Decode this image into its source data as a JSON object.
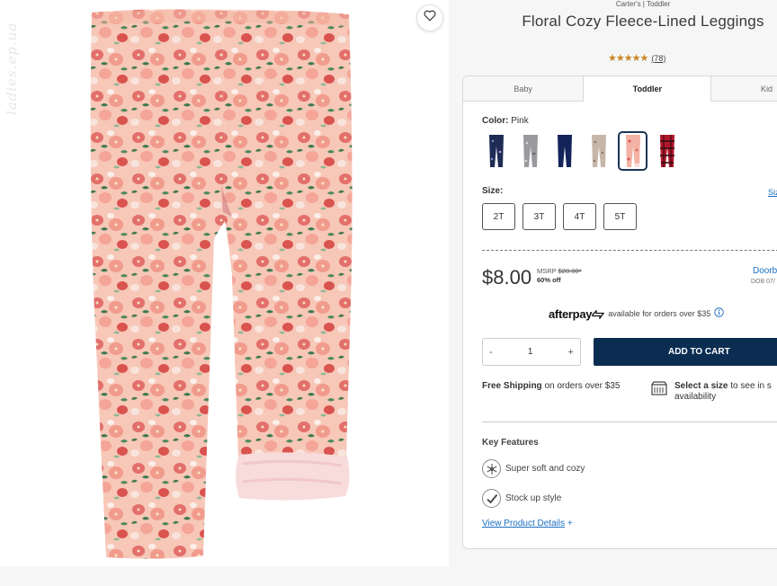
{
  "watermark": "ladies.ep.ua",
  "product": {
    "brand_line": "Carter's | Toddler",
    "title": "Floral Cozy Fleece-Lined Leggings",
    "rating_stars": "★★★★★",
    "rating_value": 4.5,
    "review_count": "(78)"
  },
  "tabs": [
    {
      "label": "Baby"
    },
    {
      "label": "Toddler",
      "active": true
    },
    {
      "label": "Kid"
    }
  ],
  "color": {
    "label": "Color:",
    "selected": "Pink",
    "swatches": [
      {
        "name": "navy-print",
        "color": "#1e2b55"
      },
      {
        "name": "gray-print",
        "color": "#9a9a9e"
      },
      {
        "name": "navy",
        "color": "#13245a"
      },
      {
        "name": "taupe-print",
        "color": "#c6b6aa"
      },
      {
        "name": "pink-floral",
        "color": "#f3b2a4",
        "selected": true
      },
      {
        "name": "red-plaid",
        "color": "#b0162a"
      }
    ]
  },
  "size": {
    "label": "Size:",
    "options": [
      "2T",
      "3T",
      "4T",
      "5T"
    ],
    "guide_label": "Siz"
  },
  "pricing": {
    "price": "$8.00",
    "msrp_label": "MSRP",
    "msrp_value": "$20.00*",
    "discount": "60% off",
    "door_label": "Doorb",
    "door_sub": "DOB 07/"
  },
  "afterpay": {
    "logo": "afterpay",
    "text": "available for orders over $35"
  },
  "quantity": {
    "minus": "-",
    "value": "1",
    "plus": "+"
  },
  "add_to_cart": "ADD TO CART",
  "shipping": {
    "bold": "Free Shipping",
    "rest": " on orders over $35"
  },
  "store": {
    "bold": "Select a size",
    "rest": " to see in s",
    "line2": "availability"
  },
  "features": {
    "title": "Key Features",
    "items": [
      {
        "label": "Super soft and cozy",
        "icon": "snowflake-icon"
      },
      {
        "label": "Stock up style",
        "icon": "checkmark-icon"
      }
    ]
  },
  "view_details": {
    "label": "View Product Details",
    "suffix": "+"
  },
  "colors": {
    "brand_navy": "#0b2d52",
    "link_blue": "#1a6fc0",
    "star_gold": "#c9851e"
  }
}
